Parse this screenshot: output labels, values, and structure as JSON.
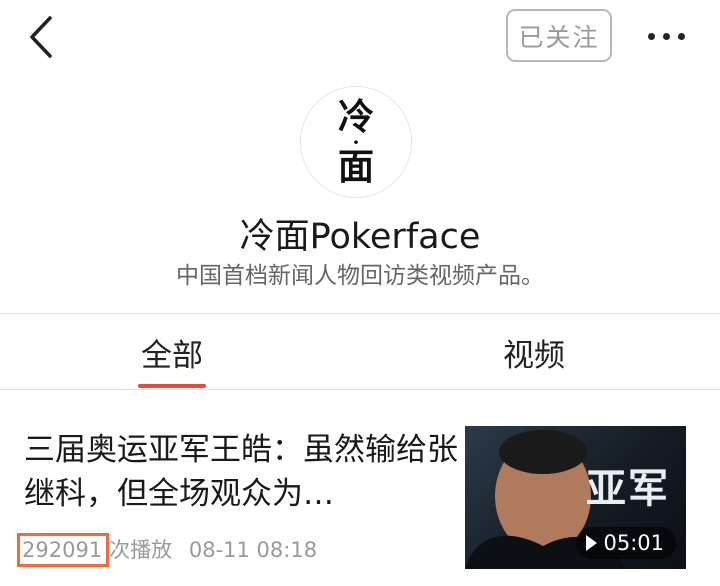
{
  "header": {
    "follow_label": "已关注"
  },
  "profile": {
    "avatar_text_top": "冷",
    "avatar_text_mid": "·",
    "avatar_text_bottom": "面",
    "name": "冷面Pokerface",
    "description": "中国首档新闻人物回访类视频产品。"
  },
  "tabs": [
    {
      "label": "全部",
      "active": true
    },
    {
      "label": "视频",
      "active": false
    }
  ],
  "article": {
    "title": "三届奥运亚军王皓：虽然输给张继科，但全场观众为…",
    "play_count": "292091",
    "play_suffix": "次播放",
    "date": "08-11 08:18",
    "duration": "05:01",
    "thumb_text": "亚军"
  },
  "colors": {
    "accent": "#e8493f",
    "highlight_box": "#ef6c3f"
  },
  "icons": {
    "back": "chevron-left-icon",
    "more": "more-horizontal-icon",
    "play": "play-icon"
  }
}
